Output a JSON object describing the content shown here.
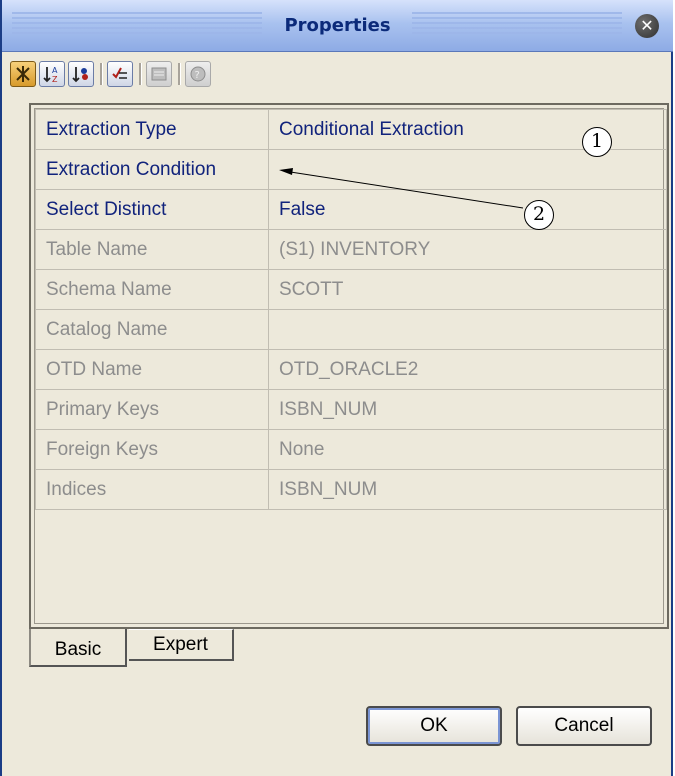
{
  "window": {
    "title": "Properties",
    "close_icon": "close-icon"
  },
  "toolbar": {
    "buttons": [
      {
        "name": "categorized-view-icon",
        "state": "active"
      },
      {
        "name": "sort-alphabetical-icon",
        "state": "normal"
      },
      {
        "name": "sort-by-category-icon",
        "state": "normal"
      },
      {
        "name": "show-description-icon",
        "state": "normal"
      },
      {
        "name": "property-editor-icon",
        "state": "disabled"
      },
      {
        "name": "help-icon",
        "state": "disabled"
      }
    ]
  },
  "properties": [
    {
      "name": "Extraction Type",
      "value": "Conditional Extraction",
      "editable": true
    },
    {
      "name": "Extraction Condition",
      "value": "",
      "editable": true
    },
    {
      "name": "Select Distinct",
      "value": "False",
      "editable": true
    },
    {
      "name": "Table Name",
      "value": "(S1) INVENTORY",
      "editable": false
    },
    {
      "name": "Schema Name",
      "value": "SCOTT",
      "editable": false
    },
    {
      "name": "Catalog Name",
      "value": "",
      "editable": false
    },
    {
      "name": "OTD Name",
      "value": "OTD_ORACLE2",
      "editable": false
    },
    {
      "name": "Primary Keys",
      "value": "ISBN_NUM",
      "editable": false
    },
    {
      "name": "Foreign Keys",
      "value": "None",
      "editable": false
    },
    {
      "name": "Indices",
      "value": "ISBN_NUM",
      "editable": false
    }
  ],
  "tabs": {
    "basic": "Basic",
    "expert": "Expert"
  },
  "buttons": {
    "ok": "OK",
    "cancel": "Cancel"
  },
  "callouts": {
    "one": "1",
    "two": "2"
  },
  "colors": {
    "enabled_text": "#11237c",
    "disabled_text": "#8d8d8d",
    "title_text": "#0b2a7a",
    "panel_bg": "#ede9db"
  }
}
